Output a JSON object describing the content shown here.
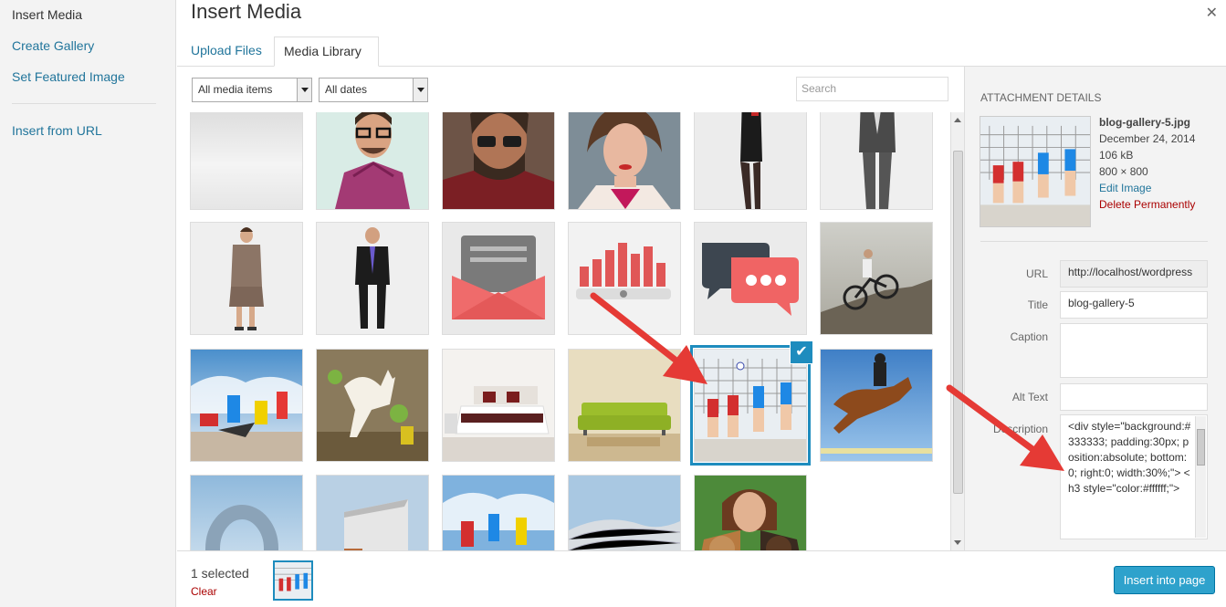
{
  "menu": {
    "items": [
      {
        "label": "Insert Media",
        "active": true
      },
      {
        "label": "Create Gallery"
      },
      {
        "label": "Set Featured Image"
      },
      {
        "label": "Insert from URL"
      }
    ]
  },
  "modal": {
    "title": "Insert Media",
    "close_icon": "close-icon"
  },
  "tabs": [
    {
      "label": "Upload Files"
    },
    {
      "label": "Media Library",
      "active": true
    }
  ],
  "filters": {
    "type_select": "All media items",
    "date_select": "All dates",
    "search_placeholder": "Search"
  },
  "media_items": [
    {
      "subject": "blank-placeholder"
    },
    {
      "subject": "man-glasses-plaid-shirt"
    },
    {
      "subject": "man-sunglasses-beard"
    },
    {
      "subject": "woman-portrait"
    },
    {
      "subject": "woman-black-dress"
    },
    {
      "subject": "man-grey-suit"
    },
    {
      "subject": "businesswoman"
    },
    {
      "subject": "businessman"
    },
    {
      "subject": "envelope-icon"
    },
    {
      "subject": "bar-chart-icon"
    },
    {
      "subject": "chat-bubbles-icon"
    },
    {
      "subject": "man-bicycle-rock"
    },
    {
      "subject": "breakdancers"
    },
    {
      "subject": "horse-surreal"
    },
    {
      "subject": "bedroom"
    },
    {
      "subject": "green-sofa"
    },
    {
      "subject": "volleyball-players",
      "selected": true
    },
    {
      "subject": "horse-jumping"
    },
    {
      "subject": "ring-building"
    },
    {
      "subject": "modern-building"
    },
    {
      "subject": "breakdancers-2"
    },
    {
      "subject": "wave-building"
    },
    {
      "subject": "woman-with-dogs"
    }
  ],
  "attachment": {
    "heading": "Attachment Details",
    "filename": "blog-gallery-5.jpg",
    "date": "December 24, 2014",
    "size": "106 kB",
    "dimensions": "800 × 800",
    "edit_label": "Edit Image",
    "delete_label": "Delete Permanently",
    "fields": {
      "url_label": "URL",
      "url_value": "http://localhost/wordpress",
      "title_label": "Title",
      "title_value": "blog-gallery-5",
      "caption_label": "Caption",
      "caption_value": "",
      "alt_label": "Alt Text",
      "alt_value": "",
      "description_label": "Description",
      "description_value": "<div style=\"background:#333333; padding:30px; position:absolute; bottom:0; right:0; width:30%;\"> <h3 style=\"color:#ffffff;\">"
    }
  },
  "footer": {
    "selected_count": "1 selected",
    "clear_label": "Clear",
    "insert_label": "Insert into page"
  },
  "colors": {
    "accent": "#1e8cbe",
    "link": "#21759b",
    "danger": "#a00000",
    "button": "#2ea2cc",
    "annotation_arrow": "#e53a35"
  }
}
